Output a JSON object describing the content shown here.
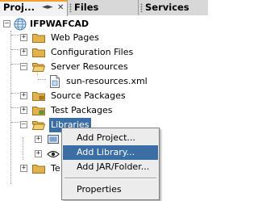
{
  "tabs": [
    {
      "label": "Proj...",
      "active": true
    },
    {
      "label": "Files",
      "active": false
    },
    {
      "label": "Services",
      "active": false
    }
  ],
  "tree": {
    "root": "IFPWAFCAD",
    "items": [
      {
        "label": "Web Pages"
      },
      {
        "label": "Configuration Files"
      },
      {
        "label": "Server Resources"
      },
      {
        "label": "sun-resources.xml"
      },
      {
        "label": "Source Packages"
      },
      {
        "label": "Test Packages"
      },
      {
        "label": "Libraries"
      },
      {
        "label": "Te"
      }
    ]
  },
  "context_menu": {
    "items": [
      {
        "label": "Add Project..."
      },
      {
        "label": "Add Library..."
      },
      {
        "label": "Add JAR/Folder..."
      },
      {
        "label": "Properties"
      }
    ]
  },
  "colors": {
    "selection": "#3a6ea5",
    "folder": "#e3b24a",
    "active_tab_accent": "#f0a030"
  }
}
